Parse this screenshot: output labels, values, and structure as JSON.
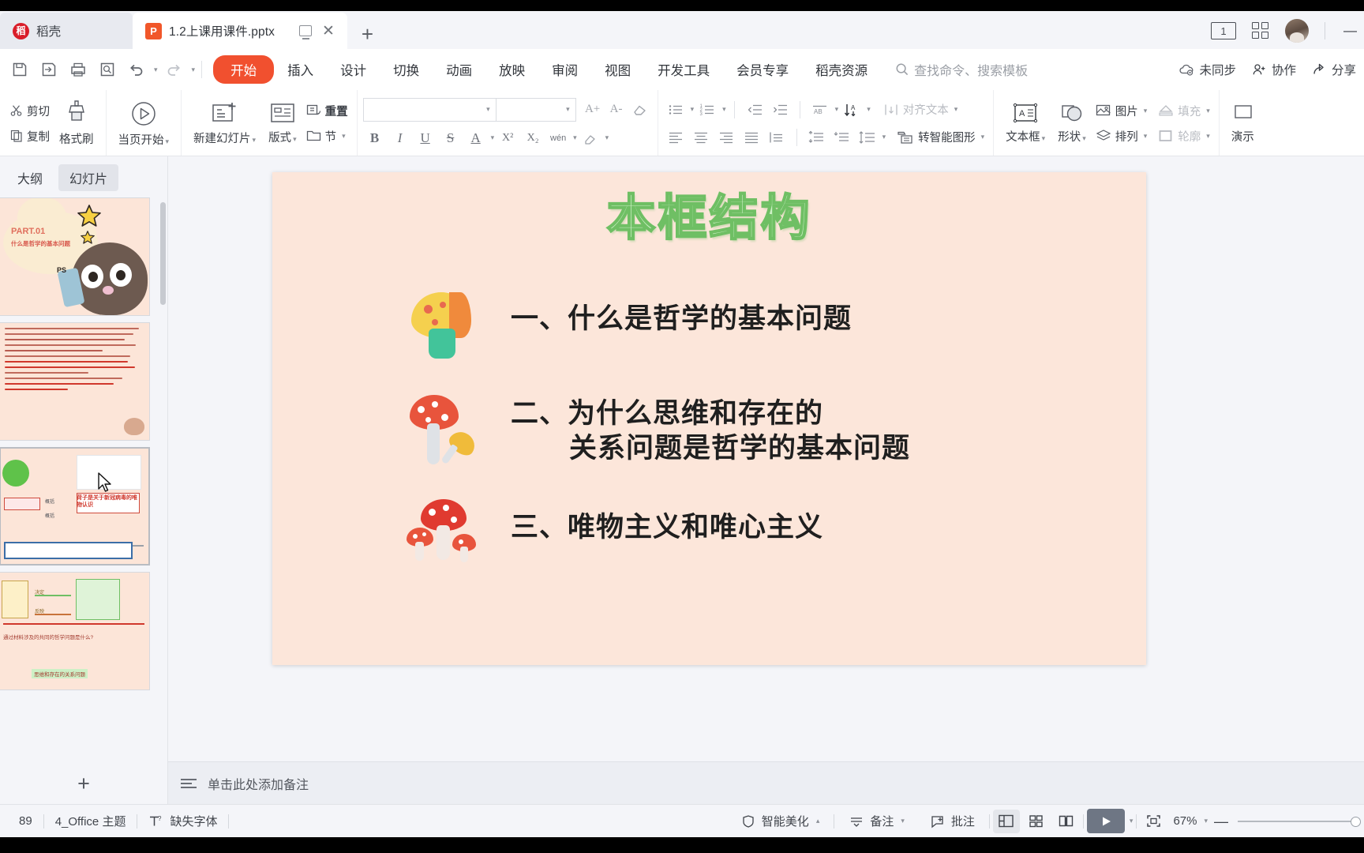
{
  "window": {
    "cloud_tab": "稻壳",
    "doc_tab": "1.2上课用课件.pptx",
    "tab_add": "+",
    "minimize": "—"
  },
  "menubar": {
    "items": [
      {
        "label": "开始",
        "active": true
      },
      {
        "label": "插入",
        "active": false
      },
      {
        "label": "设计",
        "active": false
      },
      {
        "label": "切换",
        "active": false
      },
      {
        "label": "动画",
        "active": false
      },
      {
        "label": "放映",
        "active": false
      },
      {
        "label": "审阅",
        "active": false
      },
      {
        "label": "视图",
        "active": false
      },
      {
        "label": "开发工具",
        "active": false
      },
      {
        "label": "会员专享",
        "active": false
      },
      {
        "label": "稻壳资源",
        "active": false
      }
    ],
    "search_placeholder": "查找命令、搜索模板",
    "right": [
      {
        "label": "未同步",
        "icon": "cloud-sync-icon"
      },
      {
        "label": "协作",
        "icon": "collaborate-icon"
      },
      {
        "label": "分享",
        "icon": "share-icon"
      }
    ]
  },
  "ribbon": {
    "clipboard": {
      "cut": "剪切",
      "copy": "复制",
      "format_painter": "格式刷"
    },
    "present": {
      "from_current": "当页开始"
    },
    "slides": {
      "new_slide": "新建幻灯片",
      "layout": "版式",
      "section": "节",
      "reset": "重置"
    },
    "font": {
      "name_value": "",
      "size_value": "",
      "grow": "A+",
      "shrink": "A-",
      "clear_format": "clear-format-icon",
      "bold": "B",
      "italic": "I",
      "underline": "U",
      "strike": "S",
      "font_color": "A",
      "superscript": "X²",
      "subscript": "X₂",
      "pinyin": "wén",
      "highlight": "highlight-icon"
    },
    "paragraph": {
      "bullets": "bullet-list-icon",
      "numbering": "numbered-list-icon",
      "outdent": "outdent-icon",
      "indent": "indent-icon",
      "align_left": "align-left-icon",
      "align_center": "align-center-icon",
      "align_right": "align-right-icon",
      "justify": "justify-icon",
      "distribute": "distribute-icon",
      "text_direction": "text-direction-icon",
      "sort": "sort-icon",
      "align_text": "对齐文本",
      "space_before": "space-before-icon",
      "space_after": "space-after-icon",
      "line_spacing": "line-spacing-icon",
      "to_smartart": "转智能图形"
    },
    "insert": {
      "textbox": "文本框",
      "shape": "形状",
      "picture": "图片",
      "arrange": "排列",
      "fill": "填充",
      "outline": "轮廓",
      "present_cut": "演示"
    }
  },
  "left_panel": {
    "tabs": [
      {
        "label": "大纲",
        "active": false
      },
      {
        "label": "幻灯片",
        "active": true
      }
    ],
    "add_slide": "+"
  },
  "slide": {
    "title": "本框结构",
    "items": [
      {
        "index": "一、",
        "lines": [
          "什么是哲学的基本问题"
        ],
        "mushroom": "yellow-mushroom-icon"
      },
      {
        "index": "二、",
        "lines": [
          "为什么思维和存在的",
          "关系问题是哲学的基本问题"
        ],
        "mushroom": "red-mushroom-icon"
      },
      {
        "index": "三、",
        "lines": [
          "唯物主义和唯心主义"
        ],
        "mushroom": "red-mushroom-trio-icon"
      }
    ]
  },
  "notes": {
    "placeholder": "单击此处添加备注"
  },
  "statusbar": {
    "slide_count": "89",
    "theme": "4_Office 主题",
    "missing_font": "缺失字体",
    "smart_beautify": "智能美化",
    "notes": "备注",
    "comments": "批注",
    "zoom": "67%",
    "zoom_minus": "—"
  },
  "colors": {
    "accent": "#f1502f",
    "slide_bg": "#fce6da",
    "title_fill": "#cdf0c6",
    "title_stroke": "#6fbf64",
    "play_btn": "#6e7684"
  }
}
